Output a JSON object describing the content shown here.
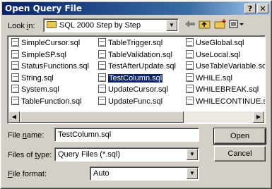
{
  "window": {
    "title": "Open Query File",
    "help_button": "?",
    "close_button": "✕"
  },
  "lookin": {
    "label_prefix": "Look ",
    "label_accel": "i",
    "label_suffix": "n:",
    "value": "SQL 2000 Step by Step"
  },
  "toolbar": {
    "back_icon": "arrow-left-icon",
    "up_icon": "folder-up-icon",
    "new_folder_icon": "new-folder-icon",
    "views_icon": "views-menu-icon"
  },
  "files": {
    "col1": [
      "SimpleCursor.sql",
      "SimpleSP.sql",
      "StatusFunctions.sql",
      "String.sql",
      "System.sql",
      "TableFunction.sql"
    ],
    "col2": [
      "TableTrigger.sql",
      "TableValidation.sql",
      "TestAfterUpdate.sql",
      "TestColumn.sql",
      "UpdateCursor.sql",
      "UpdateFunc.sql"
    ],
    "col3": [
      "UseGlobal.sql",
      "UseLocal.sql",
      "UseTableVariable.sql",
      "WHILE.sql",
      "WHILEBREAK.sql",
      "WHILECONTINUE.sql"
    ],
    "selected": "TestColumn.sql"
  },
  "filename": {
    "label_prefix": "File ",
    "label_accel": "n",
    "label_suffix": "ame:",
    "value": "TestColumn.sql"
  },
  "filetype": {
    "label_prefix": "Files of ",
    "label_accel": "t",
    "label_suffix": "ype:",
    "value": "Query Files (*.sql)"
  },
  "fileformat": {
    "label_prefix": "",
    "label_accel": "F",
    "label_suffix": "ile format:",
    "value": "Auto"
  },
  "buttons": {
    "open": "Open",
    "cancel": "Cancel"
  }
}
